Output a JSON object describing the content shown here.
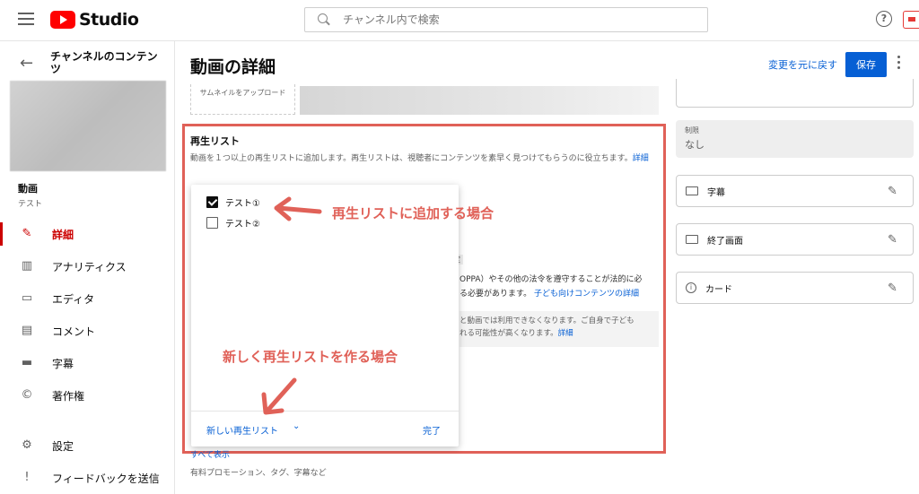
{
  "app": {
    "logo_text": "Studio"
  },
  "search": {
    "placeholder": "チャンネル内で検索"
  },
  "sidebar": {
    "channel_title": "チャンネルのコンテンツ",
    "video_label": "動画",
    "video_sub": "テスト",
    "items": [
      {
        "label": "詳細",
        "icon": "pencil-icon"
      },
      {
        "label": "アナリティクス",
        "icon": "analytics-icon"
      },
      {
        "label": "エディタ",
        "icon": "editor-icon"
      },
      {
        "label": "コメント",
        "icon": "comment-icon"
      },
      {
        "label": "字幕",
        "icon": "subtitles-icon"
      },
      {
        "label": "著作権",
        "icon": "copyright-icon"
      },
      {
        "label": "設定",
        "icon": "gear-icon"
      },
      {
        "label": "フィードバックを送信",
        "icon": "feedback-icon"
      }
    ]
  },
  "header": {
    "title": "動画の詳細",
    "undo_label": "変更を元に戻す",
    "save_label": "保存"
  },
  "main": {
    "upload_label": "サムネイルをアップロード",
    "playlist_heading": "再生リスト",
    "playlist_desc": "動画を１つ以上の再生リストに追加します。再生リストは、視聴者にコンテンツを素早く見つけてもらうのに役立ちます。",
    "playlist_link": "詳細",
    "bg_chip": "設定",
    "bg_line1": "OPPA）やその他の法令を遵守することが法的に必",
    "bg_line2": "る必要があります。",
    "bg_line2_link": "子ども向けコンテンツの詳細",
    "bg_note_line1": "と動画では利用できなくなります。ご自身で子ども",
    "bg_note_line2": "れる可能性が高くなります。",
    "bg_note_link": "詳細",
    "show_all": "すべて表示",
    "show_all_sub": "有料プロモーション、タグ、字幕など"
  },
  "dropdown": {
    "options": [
      {
        "label": "テスト①",
        "checked": true
      },
      {
        "label": "テスト②",
        "checked": false
      }
    ],
    "new_playlist_label": "新しい再生リスト",
    "done_label": "完了"
  },
  "annotations": {
    "add_existing": "再生リストに追加する場合",
    "create_new": "新しく再生リストを作る場合",
    "color": "#e06158"
  },
  "right_panel": {
    "restrict_label": "制限",
    "restrict_value": "なし",
    "subtitles_label": "字幕",
    "end_screen_label": "終了画面",
    "cards_label": "カード"
  },
  "colors": {
    "accent": "#065fd4",
    "brand": "#ff0000",
    "active": "#cc0000"
  }
}
